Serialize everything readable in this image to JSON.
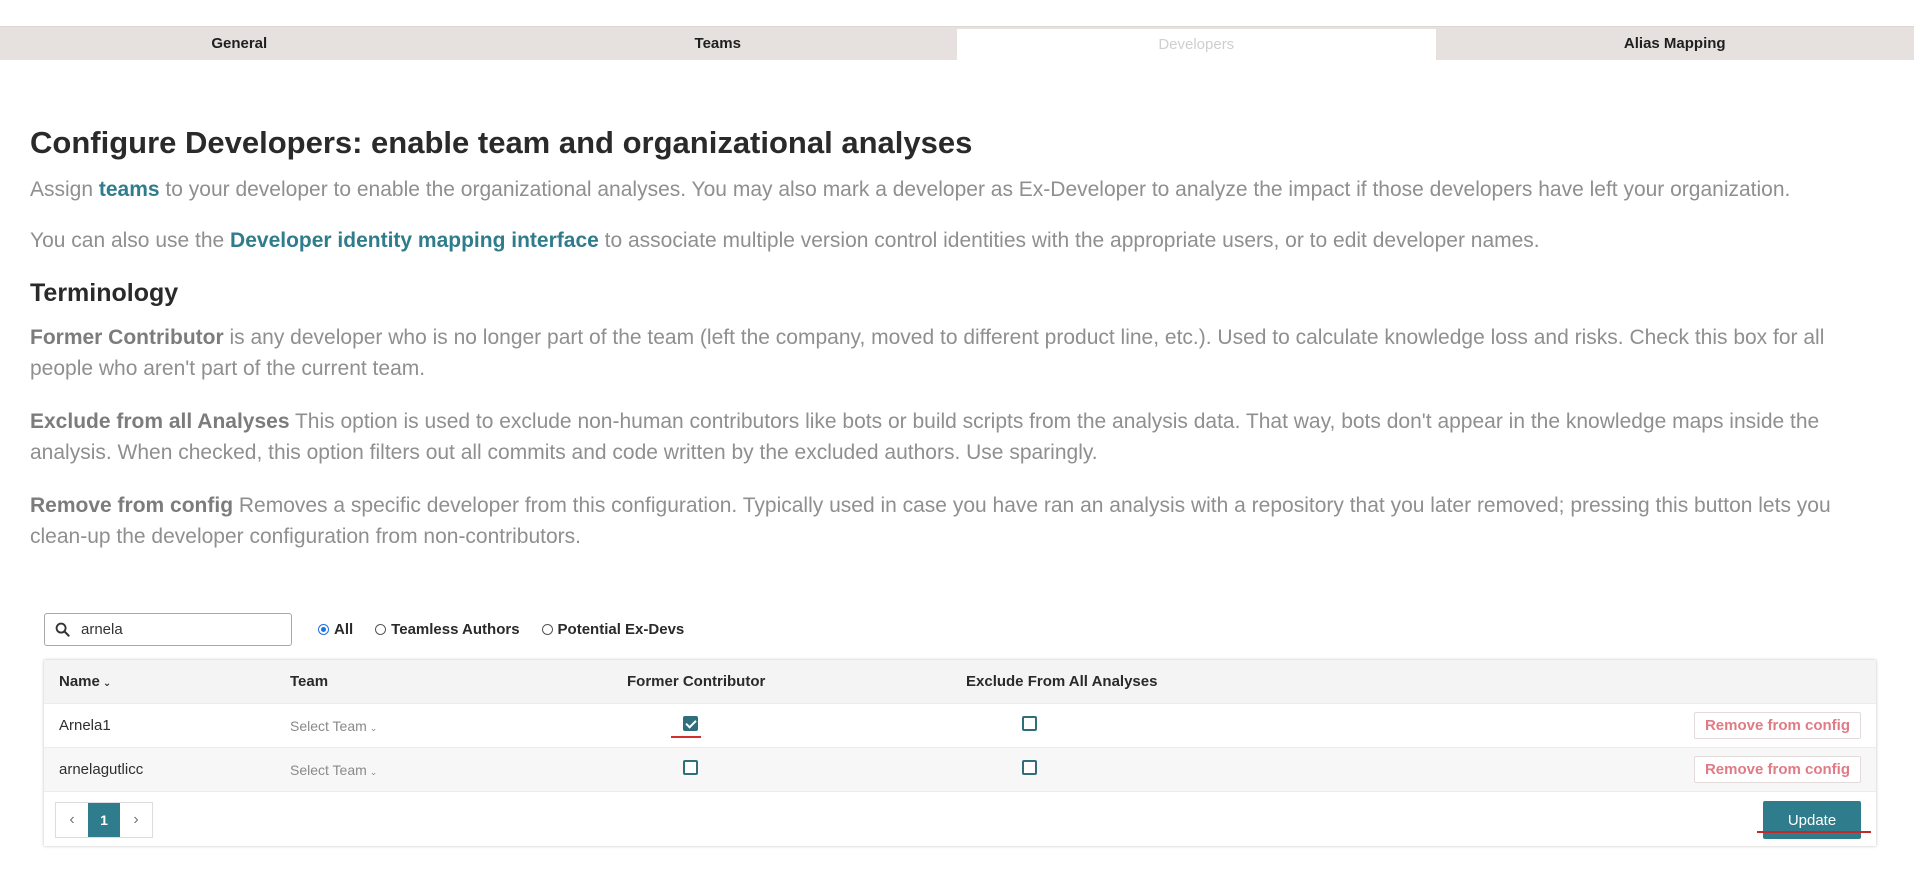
{
  "tabs": [
    "General",
    "Teams",
    "Developers",
    "Alias Mapping"
  ],
  "page": {
    "title": "Configure Developers: enable team and organizational analyses",
    "intro_before": "Assign ",
    "intro_link": "teams",
    "intro_after": " to your developer to enable the organizational analyses. You may also mark a developer as Ex-Developer to analyze the impact if those developers have left your organization.",
    "mapping_before": "You can also use the ",
    "mapping_link": "Developer identity mapping interface",
    "mapping_after": " to associate multiple version control identities with the appropriate users, or to edit developer names."
  },
  "terminology": {
    "heading": "Terminology",
    "former_name": "Former Contributor",
    "former_text": " is any developer who is no longer part of the team (left the company, moved to different product line, etc.). Used to calculate knowledge loss and risks. Check this box for all people who aren't part of the current team.",
    "exclude_name": "Exclude from all Analyses",
    "exclude_text": " This option is used to exclude non-human contributors like bots or build scripts from the analysis data. That way, bots don't appear in the knowledge maps inside the analysis. When checked, this option filters out all commits and code written by the excluded authors. Use sparingly.",
    "remove_name": "Remove from config",
    "remove_text": " Removes a specific developer from this configuration. Typically used in case you have ran an analysis with a repository that you later removed; pressing this button lets you clean-up the developer configuration from non-contributors."
  },
  "filter": {
    "search_value": "arnela",
    "radio_all": "All",
    "radio_teamless": "Teamless Authors",
    "radio_potential": "Potential Ex-Devs"
  },
  "table": {
    "headers": {
      "name": "Name",
      "team": "Team",
      "former": "Former Contributor",
      "exclude": "Exclude From All Analyses"
    },
    "rows": [
      {
        "name": "Arnela1",
        "team": "Select Team",
        "former": true,
        "exclude": false,
        "action": "Remove from config"
      },
      {
        "name": "arnelagutlicc",
        "team": "Select Team",
        "former": false,
        "exclude": false,
        "action": "Remove from config"
      }
    ]
  },
  "pagination": {
    "current": "1"
  },
  "update_label": "Update",
  "colors": {
    "accent": "#2f7d8c",
    "checkbox": "#2f6e7a",
    "remove": "#e07b85",
    "underline": "#d32f2f"
  }
}
